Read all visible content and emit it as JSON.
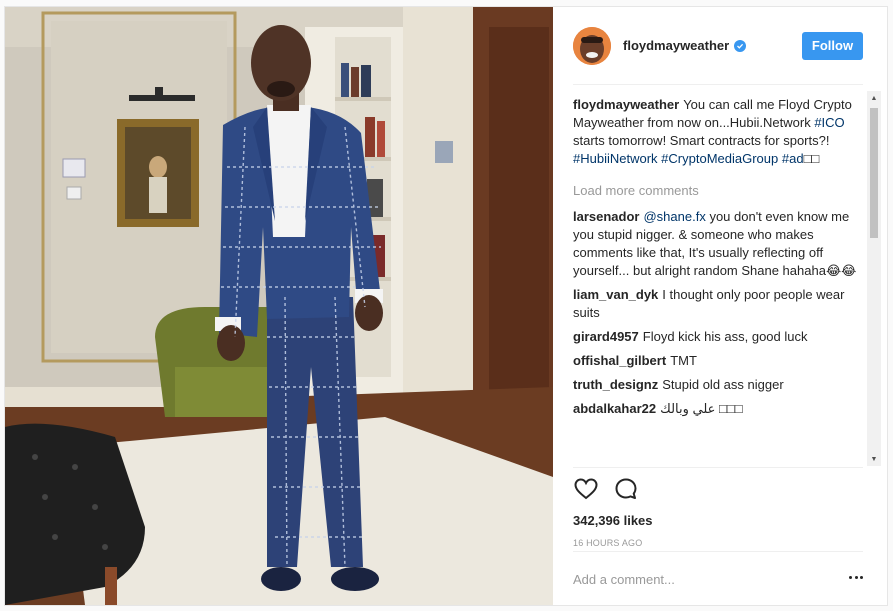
{
  "post": {
    "image_alt": "Man in a blue plaid suit standing in a room",
    "author": {
      "username": "floydmayweather",
      "verified": true
    },
    "follow_label": "Follow",
    "caption": {
      "username": "floydmayweather",
      "text_1": "You can call me Floyd Crypto Mayweather from now on...Hubii.Network ",
      "tag_1": "#ICO",
      "text_2": " starts tomorrow! Smart contracts for sports?! ",
      "tag_2": "#HubiiNetwork",
      "text_3": " ",
      "tag_3": "#CryptoMediaGroup",
      "text_4": " ",
      "tag_4": "#ad",
      "text_5": "□□"
    },
    "load_more": "Load more comments",
    "comments": [
      {
        "user": "larsenador",
        "mention": "@shane.fx",
        "text": " you don't even know me you stupid nigger. & someone who makes comments like that, It's usually reflecting off yourself... but alright random Shane hahaha😂😂"
      },
      {
        "user": "liam_van_dyk",
        "mention": "",
        "text": "I thought only poor people wear suits"
      },
      {
        "user": "girard4957",
        "mention": "",
        "text": "Floyd kick his ass, good luck"
      },
      {
        "user": "offishal_gilbert",
        "mention": "",
        "text": "TMT"
      },
      {
        "user": "truth_designz",
        "mention": "",
        "text": "Stupid old ass nigger"
      },
      {
        "user": "abdalkahar22",
        "mention": "",
        "text": "علي وبالك □□□"
      }
    ],
    "likes": "342,396 likes",
    "time": "16 HOURS AGO",
    "add_comment_placeholder": "Add a comment...",
    "colors": {
      "accent": "#3897f0",
      "hashtag": "#003569",
      "muted": "#999999"
    },
    "icons": {
      "like": "heart-icon",
      "comment": "comment-bubble-icon",
      "options": "more-dots-icon",
      "verified": "verified-badge-icon"
    }
  }
}
